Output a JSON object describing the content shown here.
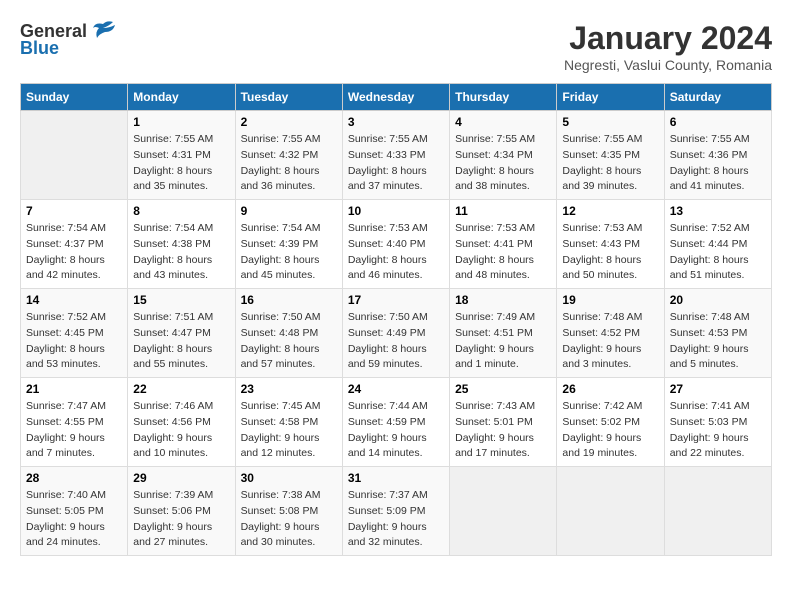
{
  "logo": {
    "general": "General",
    "blue": "Blue"
  },
  "title": "January 2024",
  "subtitle": "Negresti, Vaslui County, Romania",
  "days_of_week": [
    "Sunday",
    "Monday",
    "Tuesday",
    "Wednesday",
    "Thursday",
    "Friday",
    "Saturday"
  ],
  "weeks": [
    [
      {
        "day": "",
        "info": ""
      },
      {
        "day": "1",
        "info": "Sunrise: 7:55 AM\nSunset: 4:31 PM\nDaylight: 8 hours\nand 35 minutes."
      },
      {
        "day": "2",
        "info": "Sunrise: 7:55 AM\nSunset: 4:32 PM\nDaylight: 8 hours\nand 36 minutes."
      },
      {
        "day": "3",
        "info": "Sunrise: 7:55 AM\nSunset: 4:33 PM\nDaylight: 8 hours\nand 37 minutes."
      },
      {
        "day": "4",
        "info": "Sunrise: 7:55 AM\nSunset: 4:34 PM\nDaylight: 8 hours\nand 38 minutes."
      },
      {
        "day": "5",
        "info": "Sunrise: 7:55 AM\nSunset: 4:35 PM\nDaylight: 8 hours\nand 39 minutes."
      },
      {
        "day": "6",
        "info": "Sunrise: 7:55 AM\nSunset: 4:36 PM\nDaylight: 8 hours\nand 41 minutes."
      }
    ],
    [
      {
        "day": "7",
        "info": "Sunrise: 7:54 AM\nSunset: 4:37 PM\nDaylight: 8 hours\nand 42 minutes."
      },
      {
        "day": "8",
        "info": "Sunrise: 7:54 AM\nSunset: 4:38 PM\nDaylight: 8 hours\nand 43 minutes."
      },
      {
        "day": "9",
        "info": "Sunrise: 7:54 AM\nSunset: 4:39 PM\nDaylight: 8 hours\nand 45 minutes."
      },
      {
        "day": "10",
        "info": "Sunrise: 7:53 AM\nSunset: 4:40 PM\nDaylight: 8 hours\nand 46 minutes."
      },
      {
        "day": "11",
        "info": "Sunrise: 7:53 AM\nSunset: 4:41 PM\nDaylight: 8 hours\nand 48 minutes."
      },
      {
        "day": "12",
        "info": "Sunrise: 7:53 AM\nSunset: 4:43 PM\nDaylight: 8 hours\nand 50 minutes."
      },
      {
        "day": "13",
        "info": "Sunrise: 7:52 AM\nSunset: 4:44 PM\nDaylight: 8 hours\nand 51 minutes."
      }
    ],
    [
      {
        "day": "14",
        "info": "Sunrise: 7:52 AM\nSunset: 4:45 PM\nDaylight: 8 hours\nand 53 minutes."
      },
      {
        "day": "15",
        "info": "Sunrise: 7:51 AM\nSunset: 4:47 PM\nDaylight: 8 hours\nand 55 minutes."
      },
      {
        "day": "16",
        "info": "Sunrise: 7:50 AM\nSunset: 4:48 PM\nDaylight: 8 hours\nand 57 minutes."
      },
      {
        "day": "17",
        "info": "Sunrise: 7:50 AM\nSunset: 4:49 PM\nDaylight: 8 hours\nand 59 minutes."
      },
      {
        "day": "18",
        "info": "Sunrise: 7:49 AM\nSunset: 4:51 PM\nDaylight: 9 hours\nand 1 minute."
      },
      {
        "day": "19",
        "info": "Sunrise: 7:48 AM\nSunset: 4:52 PM\nDaylight: 9 hours\nand 3 minutes."
      },
      {
        "day": "20",
        "info": "Sunrise: 7:48 AM\nSunset: 4:53 PM\nDaylight: 9 hours\nand 5 minutes."
      }
    ],
    [
      {
        "day": "21",
        "info": "Sunrise: 7:47 AM\nSunset: 4:55 PM\nDaylight: 9 hours\nand 7 minutes."
      },
      {
        "day": "22",
        "info": "Sunrise: 7:46 AM\nSunset: 4:56 PM\nDaylight: 9 hours\nand 10 minutes."
      },
      {
        "day": "23",
        "info": "Sunrise: 7:45 AM\nSunset: 4:58 PM\nDaylight: 9 hours\nand 12 minutes."
      },
      {
        "day": "24",
        "info": "Sunrise: 7:44 AM\nSunset: 4:59 PM\nDaylight: 9 hours\nand 14 minutes."
      },
      {
        "day": "25",
        "info": "Sunrise: 7:43 AM\nSunset: 5:01 PM\nDaylight: 9 hours\nand 17 minutes."
      },
      {
        "day": "26",
        "info": "Sunrise: 7:42 AM\nSunset: 5:02 PM\nDaylight: 9 hours\nand 19 minutes."
      },
      {
        "day": "27",
        "info": "Sunrise: 7:41 AM\nSunset: 5:03 PM\nDaylight: 9 hours\nand 22 minutes."
      }
    ],
    [
      {
        "day": "28",
        "info": "Sunrise: 7:40 AM\nSunset: 5:05 PM\nDaylight: 9 hours\nand 24 minutes."
      },
      {
        "day": "29",
        "info": "Sunrise: 7:39 AM\nSunset: 5:06 PM\nDaylight: 9 hours\nand 27 minutes."
      },
      {
        "day": "30",
        "info": "Sunrise: 7:38 AM\nSunset: 5:08 PM\nDaylight: 9 hours\nand 30 minutes."
      },
      {
        "day": "31",
        "info": "Sunrise: 7:37 AM\nSunset: 5:09 PM\nDaylight: 9 hours\nand 32 minutes."
      },
      {
        "day": "",
        "info": ""
      },
      {
        "day": "",
        "info": ""
      },
      {
        "day": "",
        "info": ""
      }
    ]
  ]
}
